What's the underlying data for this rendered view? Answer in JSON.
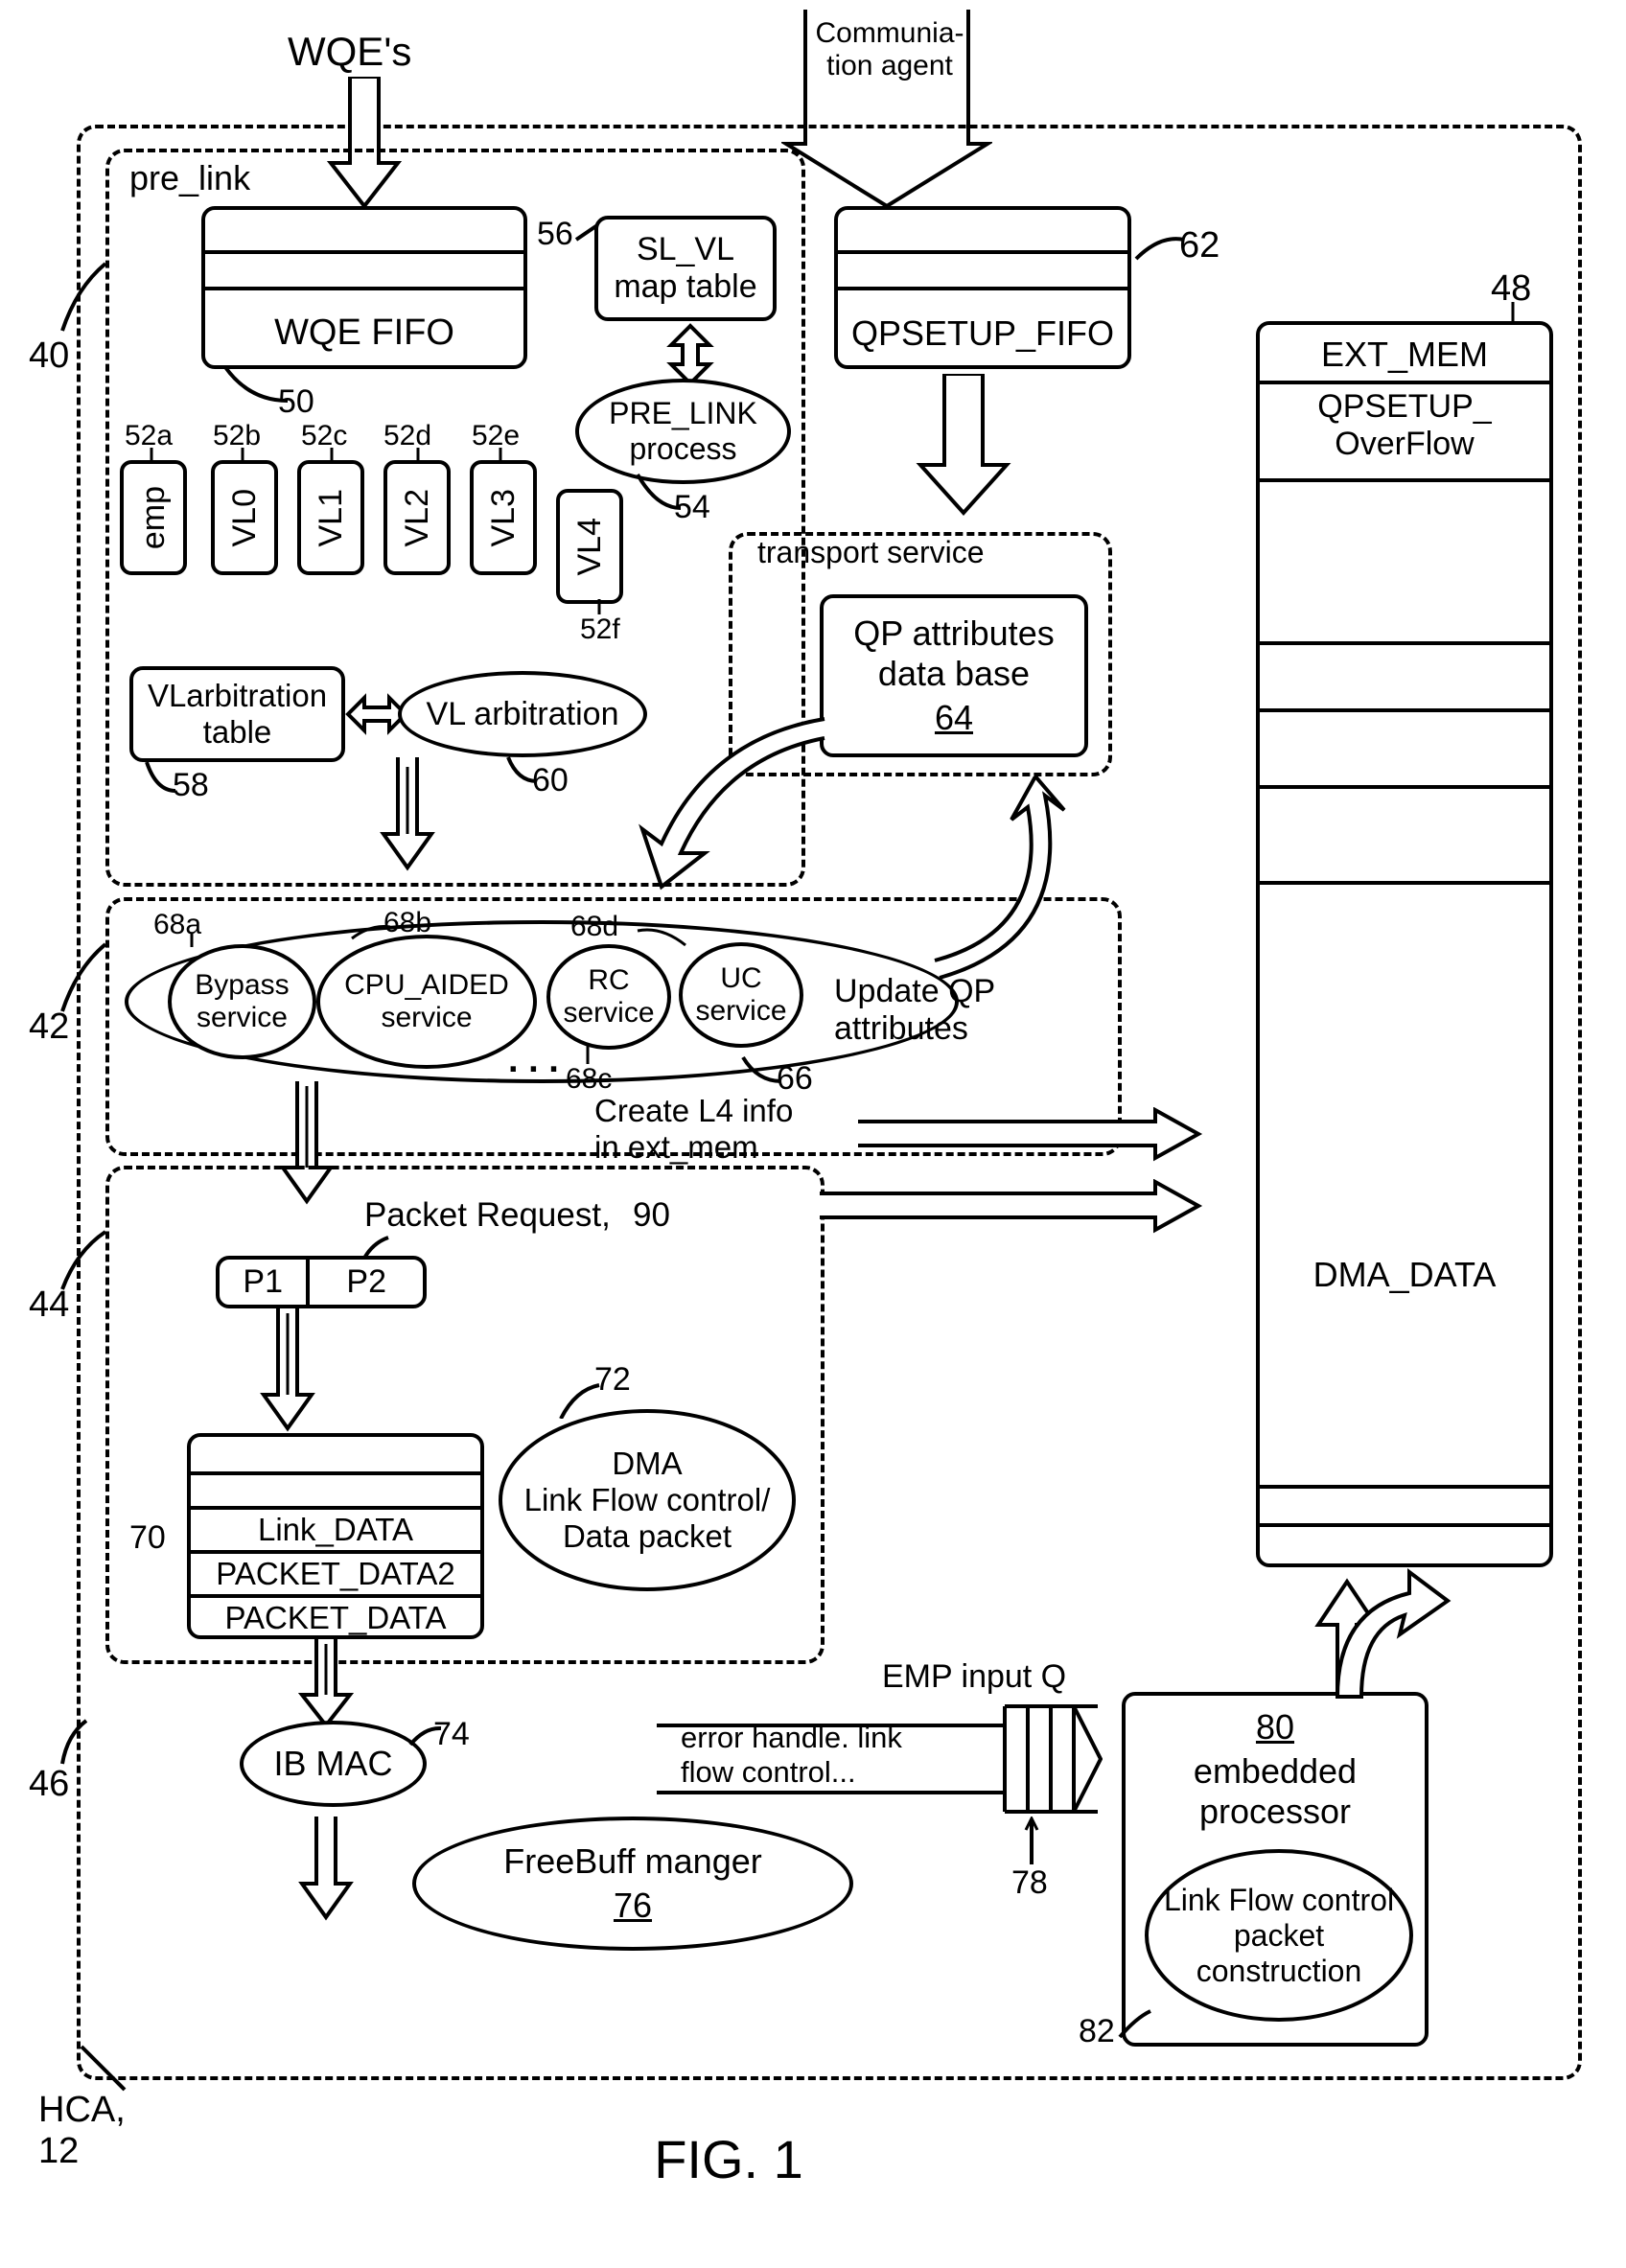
{
  "inputs": {
    "wqe": "WQE's",
    "comm_agent": "Communia-\ntion agent"
  },
  "figure_title": "FIG. 1",
  "hca_label": "HCA,\n12",
  "region_40": {
    "ref": "40",
    "title": "pre_link"
  },
  "region_42": {
    "ref": "42"
  },
  "region_44": {
    "ref": "44"
  },
  "region_46": {
    "ref": "46"
  },
  "wqe_fifo": {
    "label": "WQE FIFO",
    "ref": "50"
  },
  "sl_vl": {
    "label": "SL_VL\nmap table",
    "ref": "56"
  },
  "pre_link_proc": {
    "label": "PRE_LINK\nprocess",
    "ref": "54"
  },
  "vlslots": {
    "52a": "emp",
    "52b": "VL0",
    "52c": "VL1",
    "52d": "VL2",
    "52e": "VL3",
    "52f": "VL4"
  },
  "vl_arb_table": {
    "label": "VLarbitration\ntable",
    "ref": "58"
  },
  "vl_arb": {
    "label": "VL arbitration",
    "ref": "60"
  },
  "qpsetup_fifo": {
    "label": "QPSETUP_FIFO",
    "ref": "62"
  },
  "transport_service": {
    "title": "transport service"
  },
  "qp_db": {
    "label": "QP attributes\ndata base",
    "ref": "64"
  },
  "services_group_ref": "66",
  "services": {
    "68a": "Bypass\nservice",
    "68b": "CPU_AIDED\nservice",
    "68c": "RC\nservice",
    "68d": "UC\nservice"
  },
  "update_qp": "Update QP\nattributes",
  "create_l4": "Create L4 info\nin ext_mem",
  "packet_request": {
    "label": "Packet Request,",
    "ref": "90"
  },
  "p_slots": {
    "p1": "P1",
    "p2": "P2"
  },
  "packet_block": {
    "ref": "70",
    "rows": [
      "Link_DATA",
      "PACKET_DATA2",
      "PACKET_DATA"
    ]
  },
  "dma_ellipse": {
    "label": "DMA\nLink Flow control/\nData packet",
    "ref": "72"
  },
  "ib_mac": {
    "label": "IB MAC",
    "ref": "74"
  },
  "freebuff": {
    "label": "FreeBuff manger",
    "ref": "76"
  },
  "emp_queue": {
    "label": "EMP input Q",
    "arrow_text": "error handle. link\nflow control...",
    "ref": "78"
  },
  "embedded": {
    "label": "embedded\nprocessor",
    "ref": "80",
    "sub": "Link Flow control\npacket\nconstruction",
    "sub_ref": "82"
  },
  "ext_mem": {
    "title": "EXT_MEM",
    "ref": "48",
    "rows": [
      "QPSETUP_\nOverFlow",
      "",
      "",
      "",
      "DMA_DATA",
      "",
      ""
    ]
  }
}
